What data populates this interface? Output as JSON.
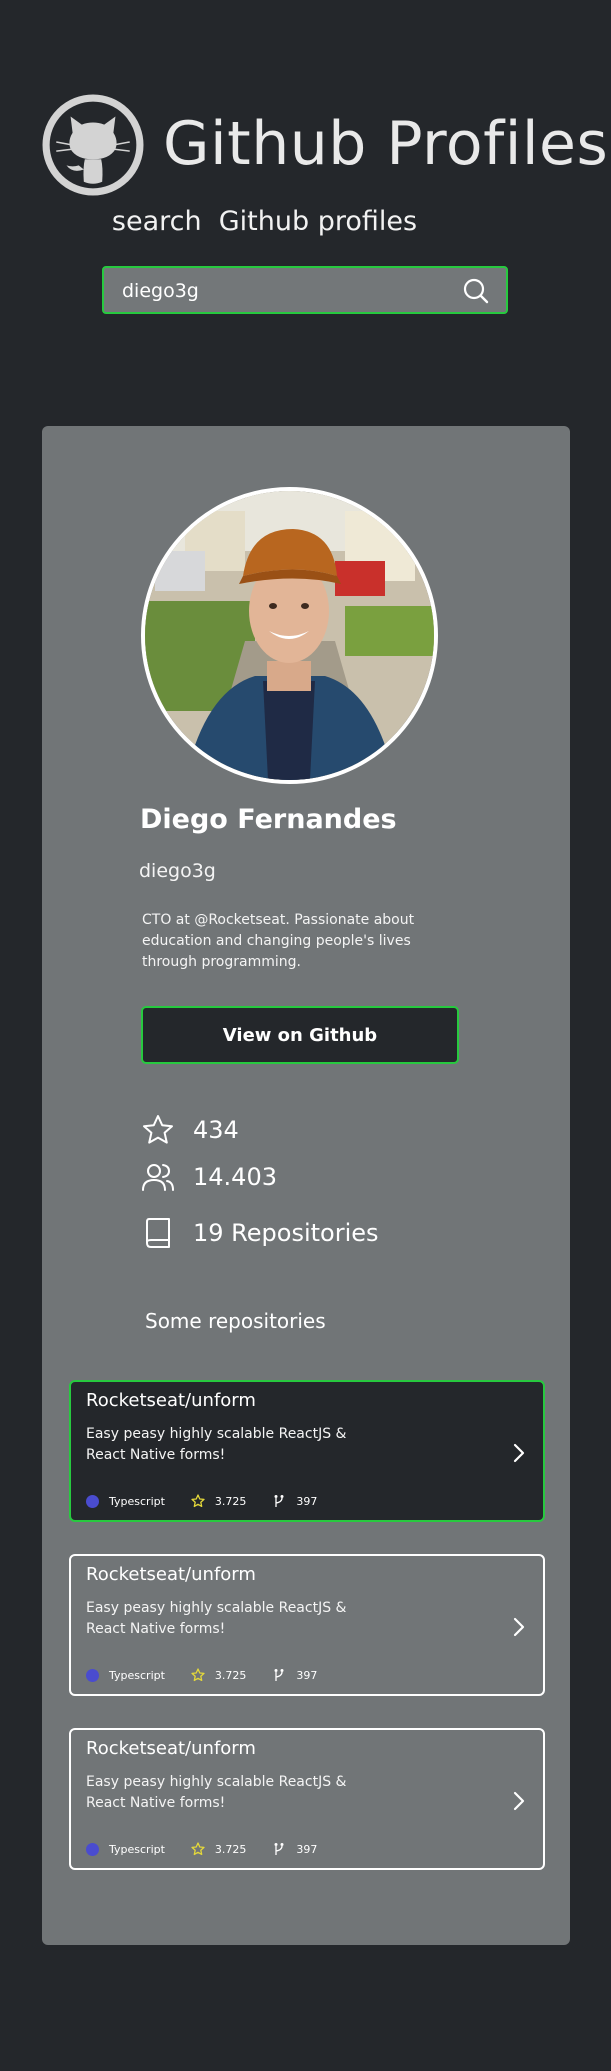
{
  "app": {
    "title": "Github Profiles",
    "subtitle": "search  Github profiles"
  },
  "search": {
    "value": "diego3g",
    "placeholder": ""
  },
  "profile": {
    "name": "Diego Fernandes",
    "login": "diego3g",
    "bio": "CTO at @Rocketseat. Passionate about education and changing people's lives through programming.",
    "button_label": "View on Github",
    "stats": {
      "stars": "434",
      "followers": "14.403",
      "repositories": "19 Repositories"
    }
  },
  "repos_section": {
    "title": "Some repositories",
    "items": [
      {
        "name": "Rocketseat/unform",
        "description": "Easy peasy highly scalable ReactJS & React Native forms!",
        "language": "Typescript",
        "stars": "3.725",
        "forks": "397"
      },
      {
        "name": "Rocketseat/unform",
        "description": "Easy peasy highly scalable ReactJS & React Native forms!",
        "language": "Typescript",
        "stars": "3.725",
        "forks": "397"
      },
      {
        "name": "Rocketseat/unform",
        "description": "Easy peasy highly scalable ReactJS & React Native forms!",
        "language": "Typescript",
        "stars": "3.725",
        "forks": "397"
      }
    ]
  },
  "colors": {
    "background": "#24272b",
    "card": "#717577",
    "accent": "#27c93f",
    "language_dot": "#4a4ccf",
    "star": "#e4d83a"
  },
  "icons": [
    "github-logo-icon",
    "search-icon",
    "star-icon",
    "followers-icon",
    "book-icon",
    "fork-icon",
    "chevron-right-icon"
  ]
}
